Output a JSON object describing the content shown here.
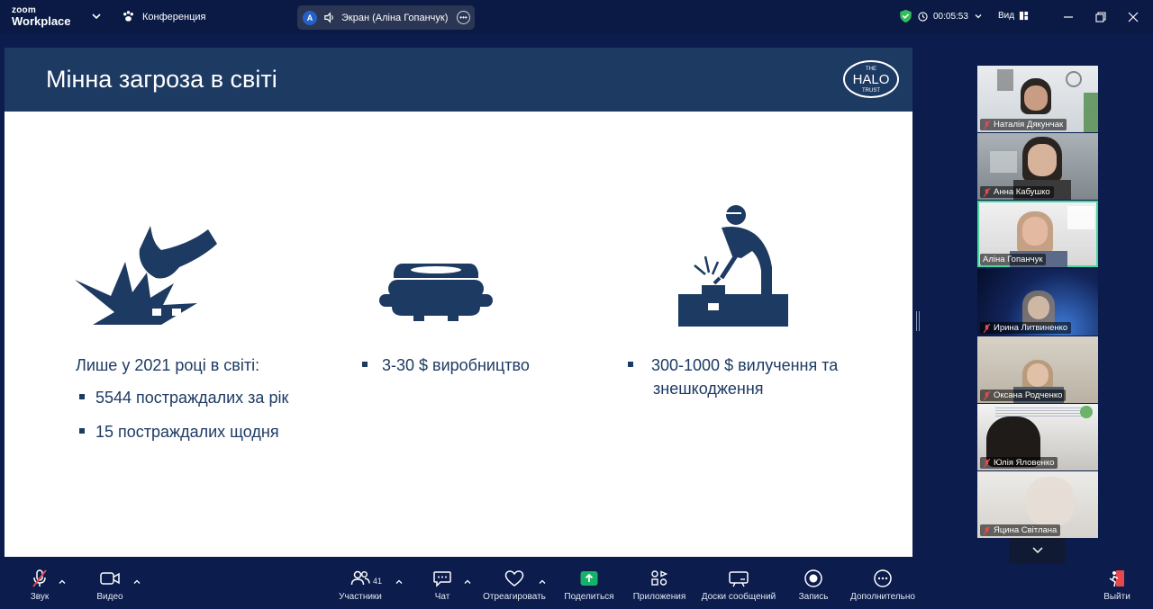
{
  "app": {
    "logo_top": "zoom",
    "logo_bottom": "Workplace",
    "meeting_title": "Конференция",
    "share_indicator": {
      "avatar_letter": "A",
      "label": "Экран (Аліна Гопанчук)"
    },
    "timer": "00:05:53",
    "view_label": "Вид"
  },
  "slide": {
    "title": "Мінна загроза в світі",
    "logo": "HALO TRUST logo",
    "col1": {
      "heading": "Лише у 2021 році в світі:",
      "bullets": [
        "5544 постраждалих за рік",
        "15 постраждалих щодня"
      ]
    },
    "col2": {
      "bullets": [
        "3-30 $ виробництво"
      ]
    },
    "col3": {
      "line1": "300-1000 $ вилучення та",
      "line2": "знешкодження"
    }
  },
  "participants": [
    {
      "name": "Наталія Дякунчак",
      "muted": true
    },
    {
      "name": "Анна Кабушко",
      "muted": true
    },
    {
      "name": "Аліна Гопанчук",
      "muted": false,
      "active": true
    },
    {
      "name": "Ирина Литвиненко",
      "muted": true
    },
    {
      "name": "Оксана Родченко",
      "muted": true
    },
    {
      "name": "Юлія Яловенко",
      "muted": true
    },
    {
      "name": "Яцина Світлана",
      "muted": true
    }
  ],
  "toolbar": {
    "audio": "Звук",
    "video": "Видео",
    "participants": "Участники",
    "participants_count": "41",
    "chat": "Чат",
    "react": "Отреагировать",
    "share": "Поделиться",
    "apps": "Приложения",
    "whiteboards": "Доски сообщений",
    "record": "Запись",
    "more": "Дополнительно",
    "leave": "Выйти"
  },
  "colors": {
    "background": "#0b1c4d",
    "slide_header": "#1d3a63",
    "share_green": "#17b26a",
    "leave_red": "#e5484d",
    "active_tile": "#4ad7a0"
  }
}
